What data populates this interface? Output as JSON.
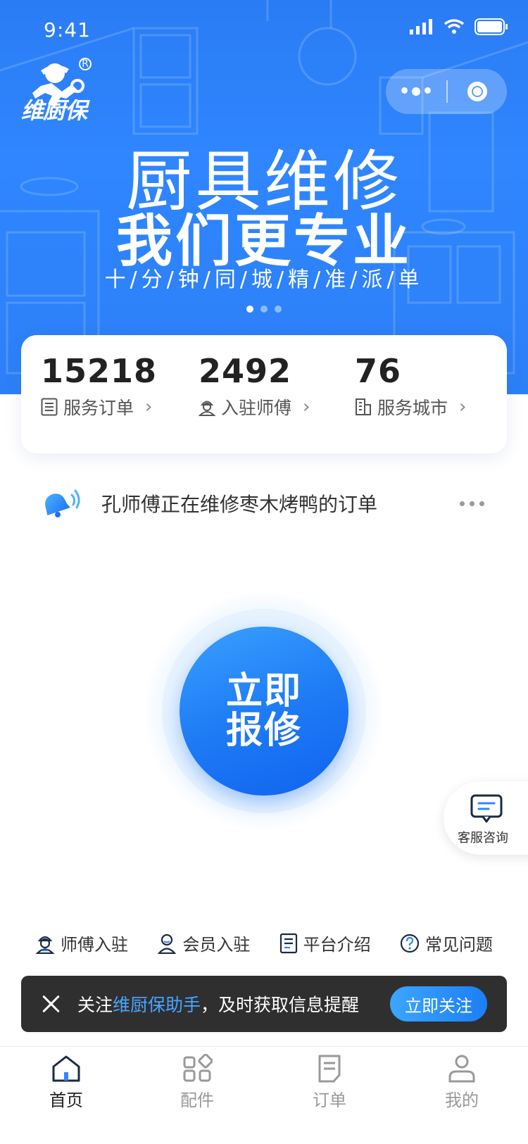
{
  "status_bar": {
    "time": "9:41"
  },
  "brand": {
    "logo_text": "维厨保",
    "registered": "R"
  },
  "hero": {
    "title": "厨具维修",
    "subtitle": "我们更专业",
    "tagline": "十/分/钟/同/城/精/准/派/单",
    "carousel": {
      "count": 3,
      "active": 0
    }
  },
  "stats": [
    {
      "value": "15218",
      "label": "服务订单",
      "icon": "list-icon"
    },
    {
      "value": "2492",
      "label": "入驻师傅",
      "icon": "worker-icon"
    },
    {
      "value": "76",
      "label": "服务城市",
      "icon": "building-icon"
    }
  ],
  "notice": {
    "text": "孔师傅正在维修枣木烤鸭的订单"
  },
  "repair_button": {
    "line1": "立即",
    "line2": "报修"
  },
  "service": {
    "label": "客服咨询"
  },
  "quick_links": [
    {
      "label": "师傅入驻",
      "icon": "worker-icon"
    },
    {
      "label": "会员入驻",
      "icon": "member-icon"
    },
    {
      "label": "平台介绍",
      "icon": "document-icon"
    },
    {
      "label": "常见问题",
      "icon": "question-icon"
    }
  ],
  "follow_bar": {
    "prefix": "关注",
    "highlight": "维厨保助手",
    "suffix": "，及时获取信息提醒",
    "button": "立即关注"
  },
  "tabs": [
    {
      "label": "首页",
      "icon": "home-icon",
      "active": true
    },
    {
      "label": "配件",
      "icon": "parts-icon",
      "active": false
    },
    {
      "label": "订单",
      "icon": "order-icon",
      "active": false
    },
    {
      "label": "我的",
      "icon": "profile-icon",
      "active": false
    }
  ],
  "colors": {
    "primary": "#1f7cf5",
    "hero": "#2f86ff",
    "dark_bar": "#2f2f30",
    "highlight": "#4aa4ff"
  }
}
